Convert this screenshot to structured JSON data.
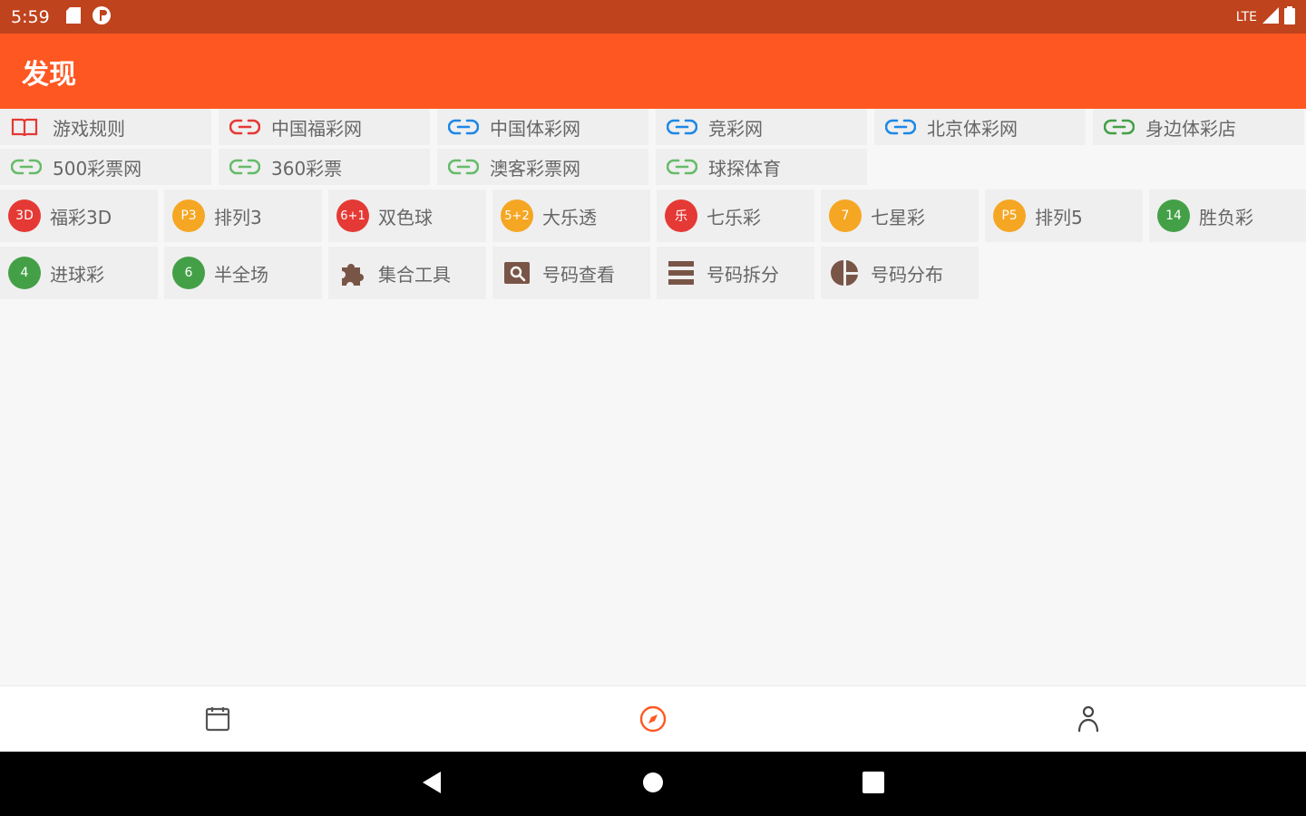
{
  "status_bar": {
    "time": "5:59",
    "network": "LTE"
  },
  "app_bar": {
    "title": "发现"
  },
  "colors": {
    "red": "#e53935",
    "orange": "#f5a623",
    "green": "#43a047",
    "brown": "#795548",
    "accent": "#ff5722",
    "status": "#bf431d"
  },
  "links": [
    {
      "label": "游戏规则",
      "icon": "book-icon"
    },
    {
      "label": "中国福彩网",
      "icon": "link-icon"
    },
    {
      "label": "中国体彩网",
      "icon": "link-icon"
    },
    {
      "label": "竞彩网",
      "icon": "link-icon"
    },
    {
      "label": "北京体彩网",
      "icon": "link-icon"
    },
    {
      "label": "身边体彩店",
      "icon": "link-icon"
    },
    {
      "label": "500彩票网",
      "icon": "link-icon"
    },
    {
      "label": "360彩票",
      "icon": "link-icon"
    },
    {
      "label": "澳客彩票网",
      "icon": "link-icon"
    },
    {
      "label": "球探体育",
      "icon": "link-icon"
    }
  ],
  "games": [
    {
      "badge": "3D",
      "label": "福彩3D"
    },
    {
      "badge": "P3",
      "label": "排列3"
    },
    {
      "badge": "6+1",
      "label": "双色球"
    },
    {
      "badge": "5+2",
      "label": "大乐透"
    },
    {
      "badge": "乐",
      "label": "七乐彩"
    },
    {
      "badge": "7",
      "label": "七星彩"
    },
    {
      "badge": "P5",
      "label": "排列5"
    },
    {
      "badge": "14",
      "label": "胜负彩"
    },
    {
      "badge": "4",
      "label": "进球彩"
    },
    {
      "badge": "6",
      "label": "半全场"
    }
  ],
  "tools": [
    {
      "label": "集合工具",
      "icon": "puzzle-icon"
    },
    {
      "label": "号码查看",
      "icon": "search-box-icon"
    },
    {
      "label": "号码拆分",
      "icon": "split-icon"
    },
    {
      "label": "号码分布",
      "icon": "pie-chart-icon"
    }
  ],
  "bottom_nav": [
    {
      "icon": "calendar-icon"
    },
    {
      "icon": "compass-icon"
    },
    {
      "icon": "person-icon"
    }
  ]
}
